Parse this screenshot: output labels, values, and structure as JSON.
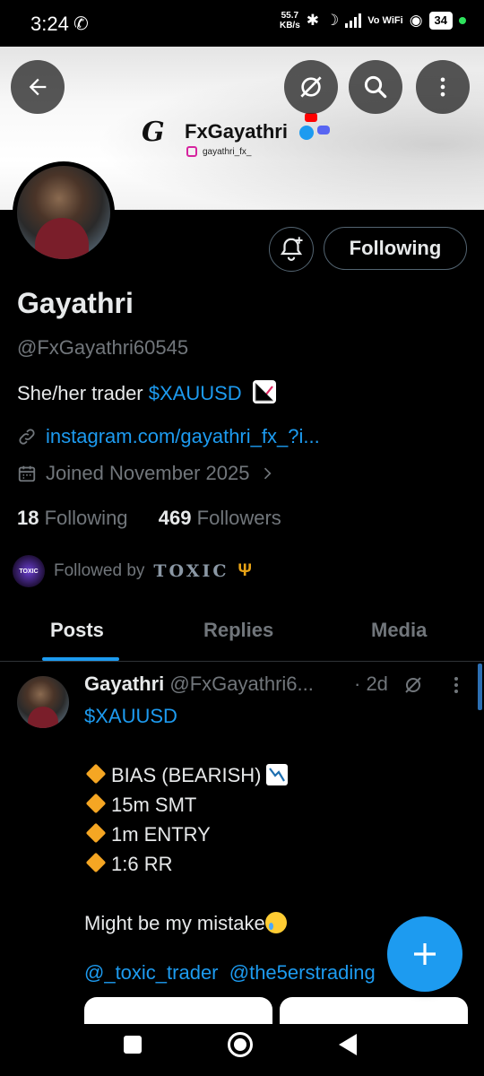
{
  "status_bar": {
    "time": "3:24",
    "speed_value": "55.7",
    "speed_unit": "KB/s",
    "network_label": "Vo WiFi",
    "battery": "34"
  },
  "banner": {
    "brand_mark": "G",
    "brand_name": "FxGayathri",
    "brand_instagram": "gayathri_fx_"
  },
  "profile": {
    "name": "Gayathri",
    "handle": "@FxGayathri60545",
    "bio_prefix": "She/her trader",
    "bio_cashtag": "$XAUUSD",
    "link": "instagram.com/gayathri_fx_?i...",
    "joined": "Joined November 2025",
    "following_count": "18",
    "following_label": "Following",
    "followers_count": "469",
    "followers_label": "Followers",
    "followed_by_prefix": "Followed by",
    "followed_by_name": "TOXIC",
    "followed_by_avatar_text": "TOXIC"
  },
  "actions": {
    "following_button": "Following"
  },
  "tabs": [
    {
      "label": "Posts",
      "active": true
    },
    {
      "label": "Replies",
      "active": false
    },
    {
      "label": "Media",
      "active": false
    }
  ],
  "post": {
    "author_name": "Gayathri",
    "author_handle": "@FxGayathri6...",
    "time": "· 2d",
    "cashtag": "$XAUUSD",
    "lines": [
      "BIAS (BEARISH)",
      "15m SMT",
      "1m ENTRY",
      "1:6 RR"
    ],
    "closing": "Might be my mistake",
    "mention_1": "@_toxic_trader",
    "mention_2": "@the5erstrading"
  },
  "colors": {
    "accent": "#1d9bf0",
    "muted": "#71767b",
    "text": "#e7e9ea",
    "background": "#000000"
  }
}
